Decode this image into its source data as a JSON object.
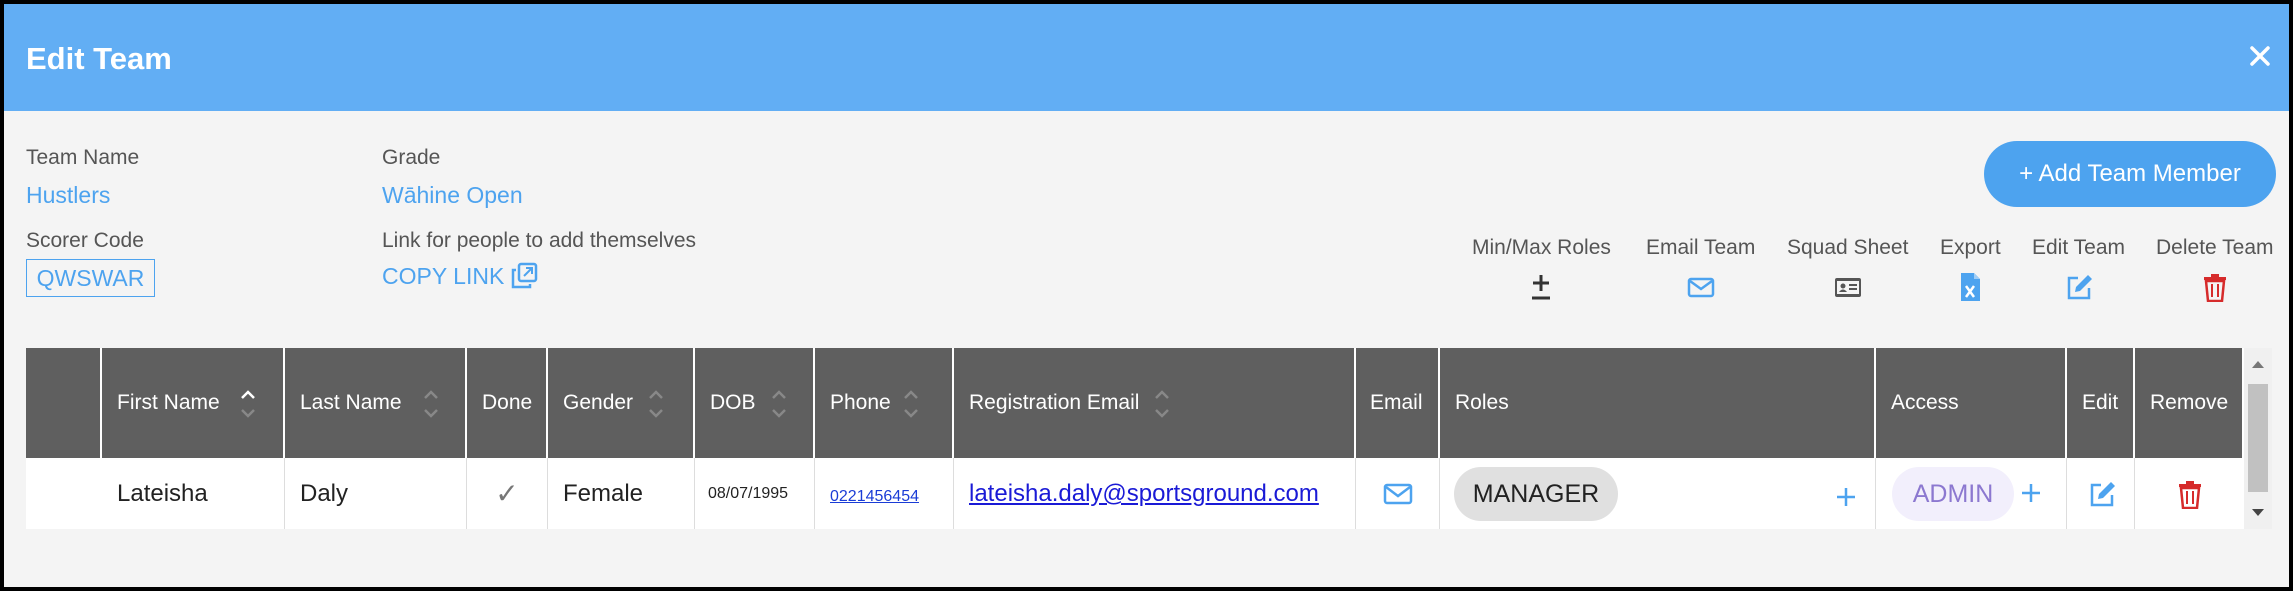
{
  "modal": {
    "title": "Edit Team"
  },
  "team": {
    "name_label": "Team Name",
    "name": "Hustlers",
    "grade_label": "Grade",
    "grade": "Wāhine Open",
    "scorer_label": "Scorer Code",
    "scorer_code": "QWSWAR",
    "link_label": "Link for people to add themselves",
    "copy_link": "COPY LINK"
  },
  "add_member_button": "+ Add Team Member",
  "actions": [
    {
      "label": "Min/Max Roles",
      "icon": "plus-minus-icon"
    },
    {
      "label": "Email Team",
      "icon": "envelope-icon"
    },
    {
      "label": "Squad Sheet",
      "icon": "id-card-icon"
    },
    {
      "label": "Export",
      "icon": "excel-file-icon"
    },
    {
      "label": "Edit Team",
      "icon": "edit-icon"
    },
    {
      "label": "Delete Team",
      "icon": "trash-icon"
    }
  ],
  "table": {
    "headers": [
      "",
      "First Name",
      "Last Name",
      "Done",
      "Gender",
      "DOB",
      "Phone",
      "Registration Email",
      "Email",
      "Roles",
      "Access",
      "Edit",
      "Remove"
    ],
    "rows": [
      {
        "first_name": "Lateisha",
        "last_name": "Daly",
        "done": "✓",
        "gender": "Female",
        "dob": "08/07/1995",
        "phone": "0221456454",
        "email": "lateisha.daly@sportsground.com",
        "role": "MANAGER",
        "access": "ADMIN"
      }
    ]
  },
  "colors": {
    "header": "#62aef4",
    "accent": "#4da3ef",
    "danger": "#d62b2b",
    "access": "#8c78d0"
  }
}
